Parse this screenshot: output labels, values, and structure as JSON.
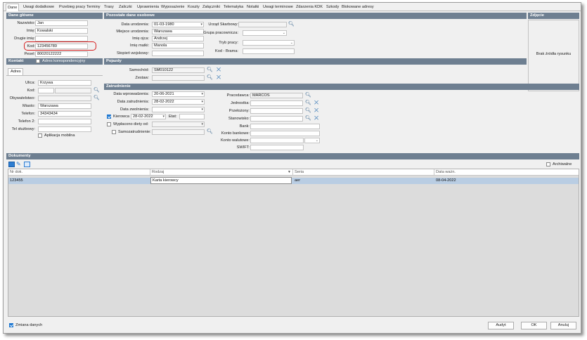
{
  "tabs": [
    "Dane",
    "Uwagi dodatkowe",
    "Przebieg pracy",
    "Terminy",
    "Trasy",
    "Zaliczki",
    "Uprawnienia",
    "Wyposażenie",
    "Koszty",
    "Załączniki",
    "Telematyka",
    "Notatki",
    "Uwagi terminowe",
    "Zdarzenia KDK",
    "Szkody",
    "Blokowane adresy"
  ],
  "dane_glowne": {
    "title": "Dane główne",
    "nazwisko_label": "Nazwisko:",
    "nazwisko": "Jan",
    "imie_label": "Imię:",
    "imie": "Kowalski",
    "drugie_label": "Drugie imię:",
    "drugie": "",
    "kod_label": "Kod:",
    "kod": "123456789",
    "pesel_label": "Pesel:",
    "pesel": "80020122222"
  },
  "pozostale": {
    "title": "Pozostałe dane osobowe",
    "data_ur_label": "Data urodzenia:",
    "data_ur": "01-03-1980",
    "miejsce_label": "Miejsce urodzenia:",
    "miejsce": "Warszawa",
    "ojca_label": "Imię ojca:",
    "ojca": "Andrzej",
    "matki_label": "Imię matki:",
    "matki": "Manola",
    "stopien_label": "Stopień wojskowy:",
    "stopien": "",
    "urzad_label": "Urząd Skarbowy:",
    "urzad": "",
    "grupa_label": "Grupa pracownicza:",
    "grupa": "",
    "tryb_label": "Tryb pracy:",
    "tryb": "",
    "brama_label": "Kod - Brama:",
    "brama": ""
  },
  "zdjecie": {
    "title": "Zdjęcie",
    "placeholder": "Brak źródła rysunku"
  },
  "kontakt": {
    "title": "Kontakt",
    "adres_kor": "Adres korespondencyjny",
    "tab": "Adres",
    "ulica_label": "Ulica:",
    "ulica": "Krzywa",
    "kod_label": "Kod:",
    "kod": "",
    "obyw_label": "Obywatelstwo:",
    "obyw": "",
    "miasto_label": "Miasto:",
    "miasto": "Warszawa",
    "telefon_label": "Telefon:",
    "telefon": "34343434",
    "tel2_label": "Telefon 2:",
    "tel2": "",
    "telsl_label": "Tel służbowy:",
    "telsl": "",
    "aplikacja": "Aplikacja mobilna"
  },
  "pojazdy": {
    "title": "Pojazdy",
    "samochod_label": "Samochód:",
    "samochod": "SM010122",
    "zestaw_label": "Zestaw:",
    "zestaw": ""
  },
  "zatrudnienie": {
    "title": "Zatrudnienie",
    "wprow_label": "Data wprowadzenia:",
    "wprow": "20-06-2021",
    "zatr_label": "Data zatrudnienia:",
    "zatr": "28-02-2022",
    "zwol_label": "Data zwolnienia:",
    "zwol": "",
    "kierowca_label": "Kierowca",
    "kierowca_date": "28-02-2022",
    "etat_label": "Etat:",
    "etat": "",
    "diety_label": "Wypłacono diety od:",
    "samo_label": "Samozatrudnienie:",
    "prac_label": "Pracodawca:",
    "prac": "MARCOS",
    "jedn_label": "Jednostka:",
    "przel_label": "Przełożony:",
    "stan_label": "Stanowisko:",
    "bank_label": "Bank:",
    "konto_b_label": "Konto bankowe:",
    "konto_w_label": "Konto walutowe:",
    "swift_label": "SWIFT:"
  },
  "dokumenty": {
    "title": "Dokumenty",
    "archiwalne": "Archiwalne",
    "headers": [
      "Nr dok.",
      "Rodzaj",
      "Seria",
      "Data ważn."
    ],
    "rows": [
      {
        "nr": "123455",
        "rodzaj": "Karta kierowcy",
        "seria": "aer",
        "data": "08-04-2022"
      }
    ]
  },
  "footer": {
    "zmiana": "Zmiana danych",
    "audyt": "Audyt",
    "ok": "OK",
    "anuluj": "Anuluj"
  },
  "colors": {
    "section": "#6e7f91",
    "highlight": "#d61e1e",
    "row_selected": "#b9cde3"
  }
}
